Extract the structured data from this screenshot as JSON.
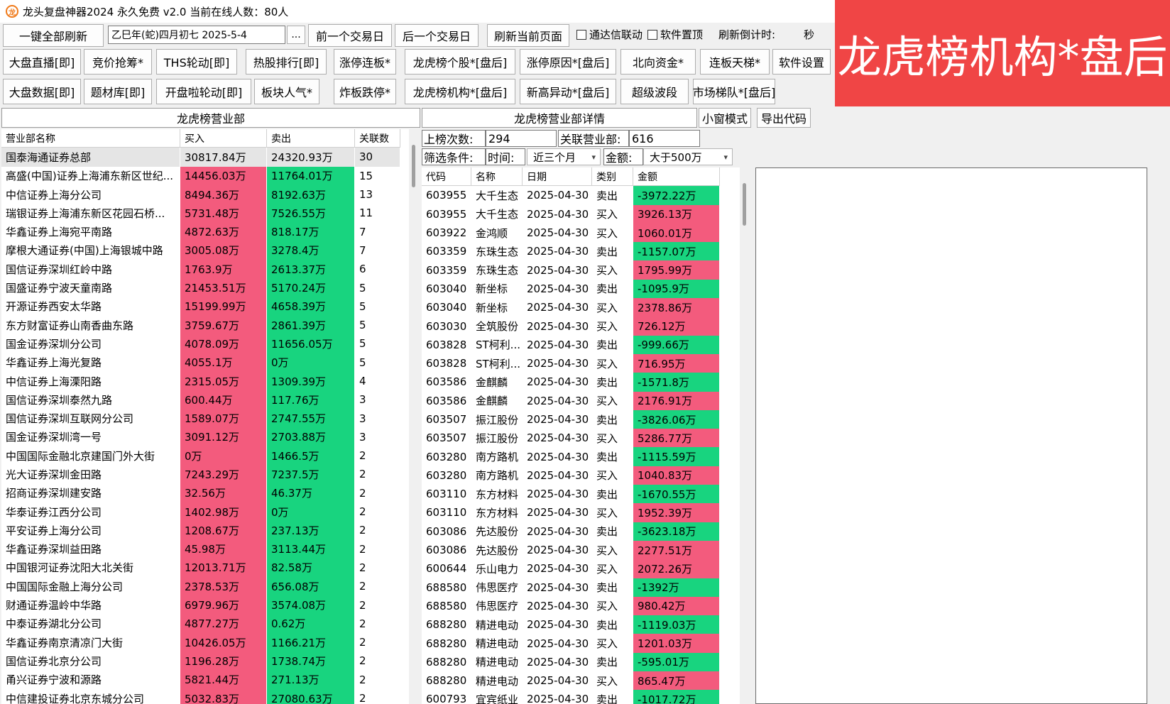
{
  "window": {
    "title": "龙头复盘神器2024 永久免费 v2.0 当前在线人数：80人",
    "icon_glyph": "龙"
  },
  "banner": {
    "text": "龙虎榜机构*盘后"
  },
  "toolbar": {
    "refresh_all": "一键全部刷新",
    "date_value": "乙巳年(蛇)四月初七  2025-5-4",
    "date_picker": "...",
    "prev_day": "前一个交易日",
    "next_day": "后一个交易日",
    "refresh_page": "刷新当前页面",
    "tdx_link": "通达信联动",
    "pin_top": "软件置顶",
    "countdown_label": "刷新倒计时:",
    "countdown_unit": "秒"
  },
  "nav_row1": [
    "大盘直播[即]",
    "竞价抢筹*",
    "THS轮动[即]",
    "热股排行[即]",
    "涨停连板*",
    "龙虎榜个股*[盘后]",
    "涨停原因*[盘后]",
    "北向资金*",
    "连板天梯*",
    "软件设置"
  ],
  "nav_row2": [
    "大盘数据[即]",
    "题材库[即]",
    "开盘啦轮动[即]",
    "板块人气*",
    "炸板跌停*",
    "龙虎榜机构*[盘后]",
    "新高异动*[盘后]",
    "超级波段",
    "市场梯队*[盘后]"
  ],
  "left_panel": {
    "title": "龙虎榜营业部",
    "columns": [
      "营业部名称",
      "买入",
      "卖出",
      "关联数"
    ],
    "rows": [
      [
        "国泰海通证券总部",
        "30817.84万",
        "24320.93万",
        "30"
      ],
      [
        "高盛(中国)证券上海浦东新区世纪...",
        "14456.03万",
        "11764.01万",
        "15"
      ],
      [
        "中信证券上海分公司",
        "8494.36万",
        "8192.63万",
        "13"
      ],
      [
        "瑞银证券上海浦东新区花园石桥...",
        "5731.48万",
        "7526.55万",
        "11"
      ],
      [
        "华鑫证券上海宛平南路",
        "4872.63万",
        "818.17万",
        "7"
      ],
      [
        "摩根大通证券(中国)上海银城中路",
        "3005.08万",
        "3278.4万",
        "7"
      ],
      [
        "国信证券深圳红岭中路",
        "1763.9万",
        "2613.37万",
        "6"
      ],
      [
        "国盛证券宁波天童南路",
        "21453.51万",
        "5170.24万",
        "5"
      ],
      [
        "开源证券西安太华路",
        "15199.99万",
        "4658.39万",
        "5"
      ],
      [
        "东方财富证券山南香曲东路",
        "3759.67万",
        "2861.39万",
        "5"
      ],
      [
        "国金证券深圳分公司",
        "4078.09万",
        "11656.05万",
        "5"
      ],
      [
        "华鑫证券上海光复路",
        "4055.1万",
        "0万",
        "5"
      ],
      [
        "中信证券上海溧阳路",
        "2315.05万",
        "1309.39万",
        "4"
      ],
      [
        "国信证券深圳泰然九路",
        "600.44万",
        "117.76万",
        "3"
      ],
      [
        "国信证券深圳互联网分公司",
        "1589.07万",
        "2747.55万",
        "3"
      ],
      [
        "国金证券深圳湾一号",
        "3091.12万",
        "2703.88万",
        "3"
      ],
      [
        "中国国际金融北京建国门外大街",
        "0万",
        "1466.5万",
        "2"
      ],
      [
        "光大证券深圳金田路",
        "7243.29万",
        "7237.5万",
        "2"
      ],
      [
        "招商证券深圳建安路",
        "32.56万",
        "46.37万",
        "2"
      ],
      [
        "华泰证券江西分公司",
        "1402.98万",
        "0万",
        "2"
      ],
      [
        "平安证券上海分公司",
        "1208.67万",
        "237.13万",
        "2"
      ],
      [
        "华鑫证券深圳益田路",
        "45.98万",
        "3113.44万",
        "2"
      ],
      [
        "中国银河证券沈阳大北关街",
        "12013.71万",
        "82.58万",
        "2"
      ],
      [
        "中国国际金融上海分公司",
        "2378.53万",
        "656.08万",
        "2"
      ],
      [
        "财通证券温岭中华路",
        "6979.96万",
        "3574.08万",
        "2"
      ],
      [
        "中泰证券湖北分公司",
        "4877.27万",
        "0.62万",
        "2"
      ],
      [
        "华鑫证券南京清凉门大街",
        "10426.05万",
        "1166.21万",
        "2"
      ],
      [
        "国信证券北京分公司",
        "1196.28万",
        "1738.74万",
        "2"
      ],
      [
        "甬兴证券宁波和源路",
        "5821.44万",
        "271.13万",
        "2"
      ],
      [
        "中信建投证券北京东城分公司",
        "5032.83万",
        "27080.63万",
        "2"
      ]
    ]
  },
  "right_panel": {
    "title": "龙虎榜营业部详情",
    "small_window": "小窗模式",
    "export_code": "导出代码",
    "count_label": "上榜次数:",
    "count_value": "294",
    "related_label": "关联营业部:",
    "related_value": "616",
    "filter_label": "筛选条件:",
    "time_label": "时间:",
    "time_value": "近三个月",
    "amount_label": "金额:",
    "amount_value": "大于500万",
    "columns": [
      "代码",
      "名称",
      "日期",
      "类别",
      "金额"
    ],
    "rows": [
      [
        "603955",
        "大千生态",
        "2025-04-30",
        "卖出",
        "-3972.22万"
      ],
      [
        "603955",
        "大千生态",
        "2025-04-30",
        "买入",
        "3926.13万"
      ],
      [
        "603922",
        "金鸿顺",
        "2025-04-30",
        "买入",
        "1060.01万"
      ],
      [
        "603359",
        "东珠生态",
        "2025-04-30",
        "卖出",
        "-1157.07万"
      ],
      [
        "603359",
        "东珠生态",
        "2025-04-30",
        "买入",
        "1795.99万"
      ],
      [
        "603040",
        "新坐标",
        "2025-04-30",
        "卖出",
        "-1095.9万"
      ],
      [
        "603040",
        "新坐标",
        "2025-04-30",
        "买入",
        "2378.86万"
      ],
      [
        "603030",
        "全筑股份",
        "2025-04-30",
        "买入",
        "726.12万"
      ],
      [
        "603828",
        "ST柯利...",
        "2025-04-30",
        "卖出",
        "-999.66万"
      ],
      [
        "603828",
        "ST柯利...",
        "2025-04-30",
        "买入",
        "716.95万"
      ],
      [
        "603586",
        "金麒麟",
        "2025-04-30",
        "卖出",
        "-1571.8万"
      ],
      [
        "603586",
        "金麒麟",
        "2025-04-30",
        "买入",
        "2176.91万"
      ],
      [
        "603507",
        "振江股份",
        "2025-04-30",
        "卖出",
        "-3826.06万"
      ],
      [
        "603507",
        "振江股份",
        "2025-04-30",
        "买入",
        "5286.77万"
      ],
      [
        "603280",
        "南方路机",
        "2025-04-30",
        "卖出",
        "-1115.59万"
      ],
      [
        "603280",
        "南方路机",
        "2025-04-30",
        "买入",
        "1040.83万"
      ],
      [
        "603110",
        "东方材料",
        "2025-04-30",
        "卖出",
        "-1670.55万"
      ],
      [
        "603110",
        "东方材料",
        "2025-04-30",
        "买入",
        "1952.39万"
      ],
      [
        "603086",
        "先达股份",
        "2025-04-30",
        "卖出",
        "-3623.18万"
      ],
      [
        "603086",
        "先达股份",
        "2025-04-30",
        "买入",
        "2277.51万"
      ],
      [
        "600644",
        "乐山电力",
        "2025-04-30",
        "买入",
        "2072.26万"
      ],
      [
        "688580",
        "伟思医疗",
        "2025-04-30",
        "卖出",
        "-1392万"
      ],
      [
        "688580",
        "伟思医疗",
        "2025-04-30",
        "买入",
        "980.42万"
      ],
      [
        "688280",
        "精进电动",
        "2025-04-30",
        "卖出",
        "-1119.03万"
      ],
      [
        "688280",
        "精进电动",
        "2025-04-30",
        "买入",
        "1201.03万"
      ],
      [
        "688280",
        "精进电动",
        "2025-04-30",
        "卖出",
        "-595.01万"
      ],
      [
        "688280",
        "精进电动",
        "2025-04-30",
        "买入",
        "865.47万"
      ],
      [
        "600793",
        "宜宾纸业",
        "2025-04-30",
        "卖出",
        "-1017.72万"
      ]
    ]
  },
  "colors": {
    "buy": "#f35b7d",
    "sell": "#18d47f",
    "banner": "#f04545"
  }
}
